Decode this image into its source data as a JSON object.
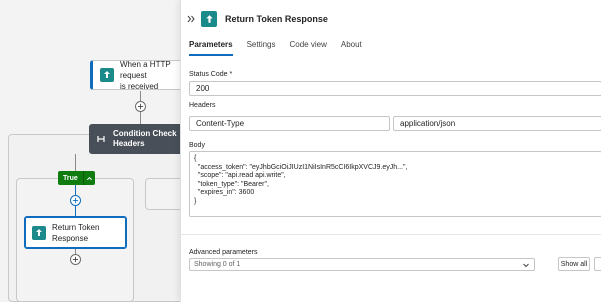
{
  "canvas": {
    "trigger": {
      "label_line1": "When a HTTP request",
      "label_line2": "is received"
    },
    "condition": {
      "label_line1": "Condition Check",
      "label_line2": "Headers"
    },
    "true_branch": {
      "label": "True"
    },
    "response_node": {
      "label_line1": "Return Token",
      "label_line2": "Response"
    }
  },
  "panel": {
    "title": "Return Token Response",
    "tabs": [
      {
        "label": "Parameters",
        "active": true
      },
      {
        "label": "Settings",
        "active": false
      },
      {
        "label": "Code view",
        "active": false
      },
      {
        "label": "About",
        "active": false
      }
    ],
    "status_code": {
      "label": "Status Code *",
      "value": "200"
    },
    "headers": {
      "label": "Headers",
      "key": "Content-Type",
      "value": "application/json"
    },
    "body": {
      "label": "Body",
      "lines": [
        "{",
        "  \"access_token\": \"eyJhbGciOiJIUzI1NiIsInR5cCI6IkpXVCJ9.eyJh...\",",
        "  \"scope\": \"api.read api.write\",",
        "  \"token_type\": \"Bearer\",",
        "  \"expires_in\": 3600",
        "}"
      ]
    },
    "advanced": {
      "label": "Advanced parameters",
      "select_value": "Showing 0 of 1",
      "show_all_label": "Show all"
    }
  },
  "colors": {
    "accent": "#0f6cbd",
    "icon_teal": "#1a8a8a",
    "true_green": "#107c10",
    "condition_dark": "#484f58"
  }
}
